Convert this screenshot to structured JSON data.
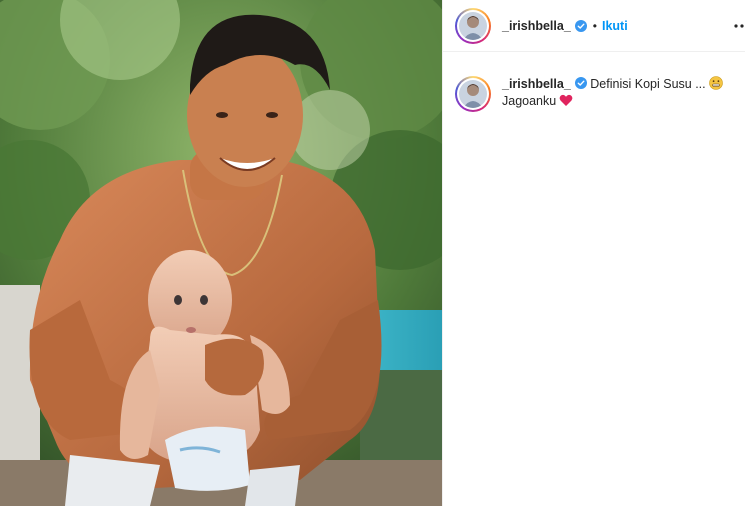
{
  "post": {
    "author": {
      "username": "_irishbella_",
      "verified": true
    },
    "header": {
      "separator": "•",
      "follow_label": "Ikuti",
      "more_icon": "more-horizontal-icon"
    },
    "caption": {
      "username": "_irishbella_",
      "line1": "Definisi Kopi Susu ...",
      "line2": "Jagoanku",
      "emoji1": "grimacing-face-emoji",
      "emoji2": "red-heart-emoji"
    },
    "photo": {
      "description_icon": "post-photo"
    }
  },
  "colors": {
    "link_blue": "#0095f6",
    "text": "#262626",
    "verified_blue": "#3897f0",
    "heart_red": "#e0245e"
  }
}
